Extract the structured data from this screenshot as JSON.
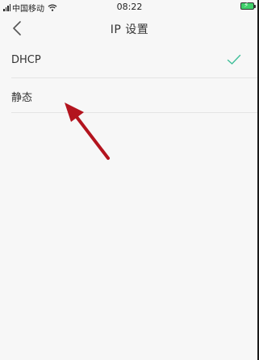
{
  "status_bar": {
    "carrier": "中国移动",
    "time": "08:22",
    "battery_color": "#3fd06a"
  },
  "nav": {
    "back_icon": "chevron-left-icon",
    "title": "IP 设置"
  },
  "options": [
    {
      "label": "DHCP",
      "selected": true
    },
    {
      "label": "静态",
      "selected": false
    }
  ],
  "colors": {
    "background": "#f7f7f7",
    "check": "#3fbf99",
    "annotation_arrow": "#b3141e"
  }
}
